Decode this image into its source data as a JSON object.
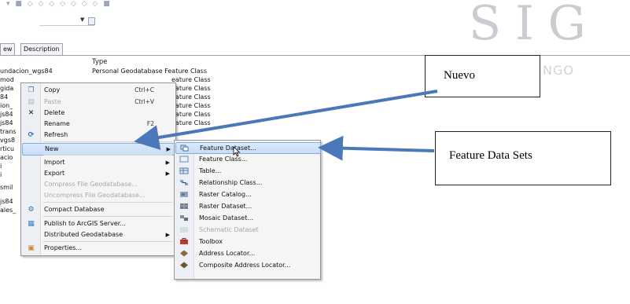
{
  "columns": {
    "type": "Type"
  },
  "tabs": [
    "ew",
    "Description"
  ],
  "watermark": {
    "letters": "SIG",
    "subtitle": "NGO"
  },
  "rows": [
    {
      "name": "undacion_wgs84",
      "type": "Personal Geodatabase Feature Class"
    },
    {
      "name": "mod",
      "type": "eature Class"
    },
    {
      "name": "gida",
      "type": "eature Class"
    },
    {
      "name": "84",
      "type": "eature Class"
    },
    {
      "name": "ion_",
      "type": "eature Class"
    },
    {
      "name": "js84",
      "type": "eature Class"
    },
    {
      "name": "js84",
      "type": "eature Class"
    },
    {
      "name": "trans",
      "type": ""
    },
    {
      "name": "vgs8",
      "type": ""
    },
    {
      "name": "rticu",
      "type": ""
    },
    {
      "name": "acio",
      "type": ""
    },
    {
      "name": "i",
      "type": ""
    },
    {
      "name": "i",
      "type": ""
    },
    {
      "name": "smil",
      "type": ""
    },
    {
      "name": "js84",
      "type": ""
    },
    {
      "name": "ales_",
      "type": ""
    }
  ],
  "context_menu": {
    "items": [
      {
        "label": "Copy",
        "shortcut": "Ctrl+C",
        "icon": "copy-icon",
        "disabled": false
      },
      {
        "label": "Paste",
        "shortcut": "Ctrl+V",
        "icon": "paste-icon",
        "disabled": true
      },
      {
        "label": "Delete",
        "shortcut": "",
        "icon": "delete-icon",
        "disabled": false
      },
      {
        "label": "Rename",
        "shortcut": "F2",
        "icon": "",
        "disabled": false
      },
      {
        "label": "Refresh",
        "shortcut": "",
        "icon": "refresh-icon",
        "disabled": false
      },
      {
        "label": "New",
        "shortcut": "",
        "icon": "",
        "disabled": false
      },
      {
        "label": "Import",
        "shortcut": "",
        "icon": "",
        "disabled": false
      },
      {
        "label": "Export",
        "shortcut": "",
        "icon": "",
        "disabled": false
      },
      {
        "label": "Compress File Geodatabase...",
        "shortcut": "",
        "icon": "",
        "disabled": true
      },
      {
        "label": "Uncompress File Geodatabase...",
        "shortcut": "",
        "icon": "",
        "disabled": true
      },
      {
        "label": "Compact Database",
        "shortcut": "",
        "icon": "compact-database-icon",
        "disabled": false
      },
      {
        "label": "Publish to ArcGIS Server...",
        "shortcut": "",
        "icon": "publish-icon",
        "disabled": false
      },
      {
        "label": "Distributed Geodatabase",
        "shortcut": "",
        "icon": "",
        "disabled": false
      },
      {
        "label": "Properties...",
        "shortcut": "",
        "icon": "properties-icon",
        "disabled": false
      }
    ]
  },
  "submenu": {
    "items": [
      {
        "label": "Feature Dataset...",
        "disabled": false
      },
      {
        "label": "Feature Class...",
        "disabled": false
      },
      {
        "label": "Table...",
        "disabled": false
      },
      {
        "label": "Relationship Class...",
        "disabled": false
      },
      {
        "label": "Raster Catalog...",
        "disabled": false
      },
      {
        "label": "Raster Dataset...",
        "disabled": false
      },
      {
        "label": "Mosaic Dataset...",
        "disabled": false
      },
      {
        "label": "Schematic Dataset",
        "disabled": true
      },
      {
        "label": "Toolbox",
        "disabled": false
      },
      {
        "label": "Address Locator...",
        "disabled": false
      },
      {
        "label": "Composite Address Locator...",
        "disabled": false
      }
    ]
  },
  "callouts": {
    "nuevo": "Nuevo",
    "feature_data_sets": "Feature Data Sets"
  },
  "colors": {
    "arrow": "#4a78b8",
    "highlight": "#c8ddf6"
  }
}
